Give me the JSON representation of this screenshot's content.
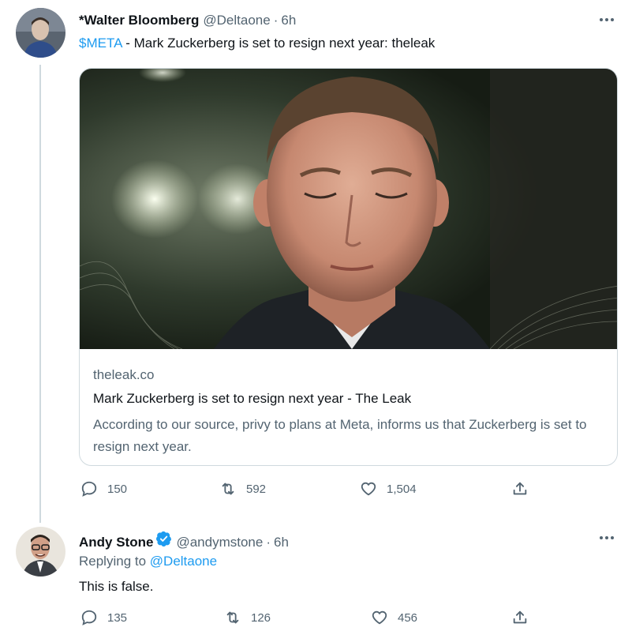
{
  "tweet1": {
    "display_name": "*Walter Bloomberg",
    "handle": "@Deltaone",
    "separator": "·",
    "time": "6h",
    "cashtag": "$META",
    "text": " - Mark Zuckerberg is set to resign next year: theleak",
    "card": {
      "domain": "theleak.co",
      "title": "Mark Zuckerberg is set to resign next year - The Leak",
      "description": "According to our source, privy to plans at Meta, informs us that Zuckerberg is set to resign next year."
    },
    "stats": {
      "replies": "150",
      "retweets": "592",
      "likes": "1,504"
    }
  },
  "tweet2": {
    "display_name": "Andy Stone",
    "handle": "@andymstone",
    "separator": "·",
    "time": "6h",
    "replying_to_label": "Replying to ",
    "replying_to_handle": "@Deltaone",
    "text": "This is false.",
    "stats": {
      "replies": "135",
      "retweets": "126",
      "likes": "456"
    }
  },
  "icons": {
    "reply": "reply-icon",
    "retweet": "retweet-icon",
    "like": "heart-icon",
    "share": "share-icon",
    "verified": "verified-badge-icon",
    "more": "more-options-icon"
  },
  "colors": {
    "accent": "#1d9bf0",
    "secondary_text": "#536471",
    "primary_text": "#0f1419",
    "border": "#cfd9de"
  }
}
